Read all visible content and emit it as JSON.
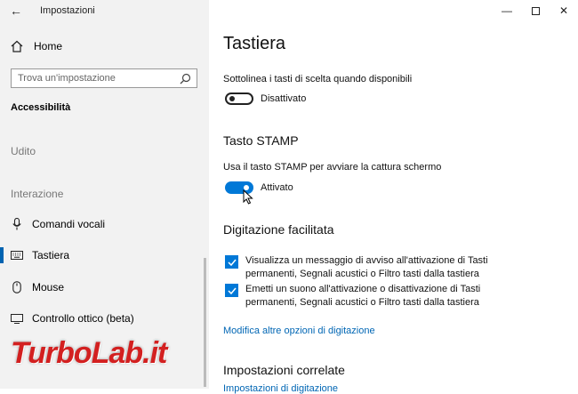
{
  "app": {
    "title": "Impostazioni"
  },
  "sidebar": {
    "home_label": "Home",
    "search_placeholder": "Trova un'impostazione",
    "section_title": "Accessibilità",
    "udito_label": "Udito",
    "group_label": "Interazione",
    "items": [
      {
        "label": "Comandi vocali",
        "icon": "microphone-icon"
      },
      {
        "label": "Tastiera",
        "icon": "keyboard-icon",
        "selected": true
      },
      {
        "label": "Mouse",
        "icon": "mouse-icon"
      },
      {
        "label": "Controllo ottico (beta)",
        "icon": "eye-icon"
      }
    ]
  },
  "main": {
    "title": "Tastiera",
    "underline": {
      "label": "Sottolinea i tasti di scelta quando disponibili",
      "state": "Disattivato"
    },
    "stamp": {
      "heading": "Tasto STAMP",
      "label": "Usa il tasto STAMP per avviare la cattura schermo",
      "state": "Attivato"
    },
    "typing": {
      "heading": "Digitazione facilitata",
      "options": [
        {
          "line1": "Visualizza un messaggio di avviso all'attivazione di Tasti",
          "line2": "permanenti, Segnali acustici o Filtro tasti dalla tastiera",
          "checked": true
        },
        {
          "line1": "Emetti un suono all'attivazione o disattivazione di Tasti",
          "line2": "permanenti, Segnali acustici o Filtro tasti dalla tastiera",
          "checked": true
        }
      ],
      "link": "Modifica altre opzioni di digitazione"
    },
    "related": {
      "heading": "Impostazioni correlate",
      "link_partial": "Impostazioni di digitazione"
    }
  },
  "watermark": {
    "text": "TurboLab.it"
  },
  "colors": {
    "accent": "#0078d7",
    "link": "#0066b4",
    "watermark": "#d32020"
  }
}
